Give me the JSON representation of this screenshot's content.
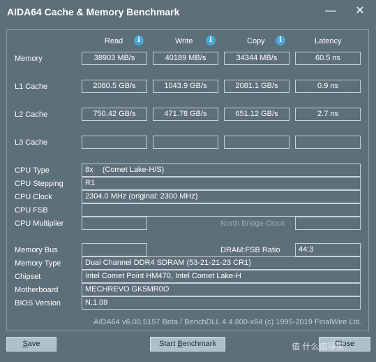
{
  "window": {
    "title": "AIDA64 Cache & Memory Benchmark",
    "minimize_glyph": "—",
    "close_glyph": "✕"
  },
  "columns": {
    "read": "Read",
    "write": "Write",
    "copy": "Copy",
    "latency": "Latency",
    "info_glyph": "i"
  },
  "rows": {
    "memory": {
      "label": "Memory",
      "read": "38903 MB/s",
      "write": "40189 MB/s",
      "copy": "34344 MB/s",
      "latency": "60.5 ns"
    },
    "l1": {
      "label": "L1 Cache",
      "read": "2080.5 GB/s",
      "write": "1043.9 GB/s",
      "copy": "2081.1 GB/s",
      "latency": "0.9 ns"
    },
    "l2": {
      "label": "L2 Cache",
      "read": "750.42 GB/s",
      "write": "471.78 GB/s",
      "copy": "651.12 GB/s",
      "latency": "2.7 ns"
    },
    "l3": {
      "label": "L3 Cache",
      "read": "",
      "write": "",
      "copy": "",
      "latency": ""
    }
  },
  "cpu": {
    "type_label": "CPU Type",
    "type_count": "8x",
    "type_value": "(Comet Lake-H/S)",
    "stepping_label": "CPU Stepping",
    "stepping_value": "R1",
    "clock_label": "CPU Clock",
    "clock_value": "2304.0 MHz  (original: 2300 MHz)",
    "fsb_label": "CPU FSB",
    "fsb_value": "",
    "multiplier_label": "CPU Multiplier",
    "multiplier_value": "",
    "north_bridge_label": "North Bridge Clock"
  },
  "memory_info": {
    "bus_label": "Memory Bus",
    "bus_value": "",
    "ratio_label": "DRAM:FSB Ratio",
    "ratio_value": "44:3",
    "type_label": "Memory Type",
    "type_value": "Dual Channel DDR4 SDRAM  (53-21-21-23 CR1)",
    "chipset_label": "Chipset",
    "chipset_value": "Intel Comet Point HM470, Intel Comet Lake-H",
    "motherboard_label": "Motherboard",
    "motherboard_value": "MECHREVO GK5MR0O",
    "bios_label": "BIOS Version",
    "bios_value": "N.1.09"
  },
  "footer": "AIDA64 v6.00.5157 Beta / BenchDLL 4.4.800-x64  (c) 1995-2019 FinalWire Ltd.",
  "buttons": {
    "save_first": "S",
    "save_rest": "ave",
    "start_pre": "Start ",
    "start_u": "B",
    "start_post": "enchmark",
    "close_partial": "Close"
  },
  "watermark": "值 什么值得买"
}
